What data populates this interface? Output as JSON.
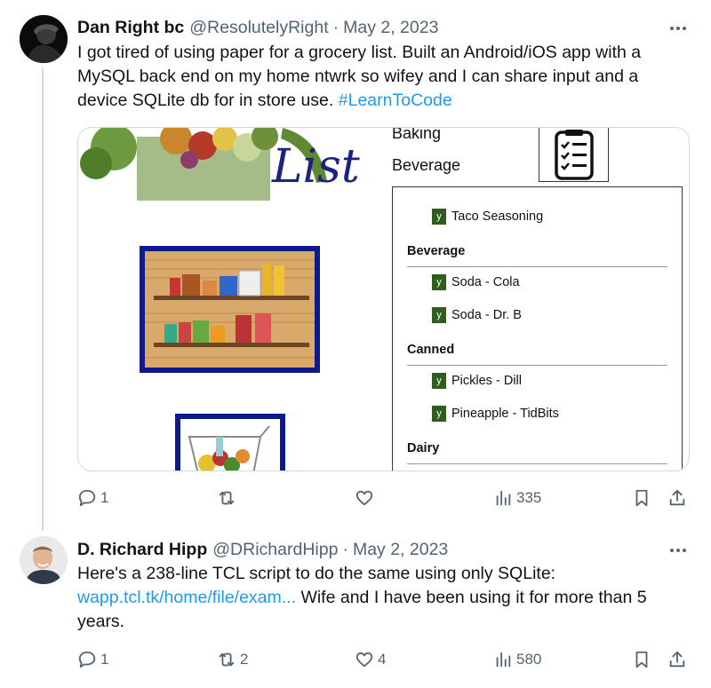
{
  "tweets": [
    {
      "name": "Dan Right bc",
      "handle": "@ResolutelyRight",
      "separator": "·",
      "date": "May 2, 2023",
      "text_main": "I got tired of using paper for a grocery list. Built an Android/iOS app with a MySQL back end on my home ntwrk so wifey and I can share input and a device SQLite db for in store use. ",
      "hashtag": "#LearnToCode",
      "media": {
        "list_word": "List",
        "side_labels": [
          "Baking",
          "Beverage"
        ],
        "categories": [
          "Beverage",
          "Canned",
          "Dairy"
        ],
        "checkbox_mark": "y",
        "items": [
          "Taco Seasoning",
          "Soda - Cola",
          "Soda - Dr. B",
          "Pickles - Dill",
          "Pineapple  - TidBits"
        ]
      },
      "actions": {
        "replies": "1",
        "reposts": "",
        "likes": "",
        "views": "335"
      }
    },
    {
      "name": "D. Richard Hipp",
      "handle": "@DRichardHipp",
      "separator": "·",
      "date": "May 2, 2023",
      "text_intro": "Here's a 238-line TCL script to do the same using only SQLite: ",
      "link": "wapp.tcl.tk/home/file/exam...",
      "text_rest": "  Wife and I have been using it for more than 5 years.",
      "actions": {
        "replies": "1",
        "reposts": "2",
        "likes": "4",
        "views": "580"
      }
    }
  ],
  "icons": {
    "reply": "reply-icon",
    "repost": "repost-icon",
    "like": "heart-icon",
    "views": "views-icon",
    "bookmark": "bookmark-icon",
    "share": "share-icon",
    "more": "more-icon"
  },
  "colors": {
    "link": "#1d9bf0",
    "muted": "#536471",
    "text": "#0f1419",
    "frame_blue": "#0d1a8c",
    "check_green": "#2e5d1e"
  }
}
